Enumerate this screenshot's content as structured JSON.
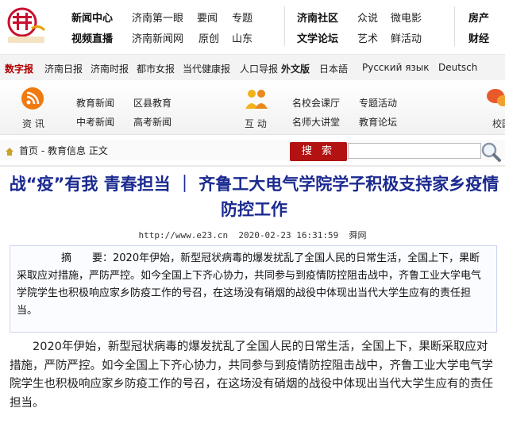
{
  "colors": {
    "accent_red": "#b00000",
    "title_blue": "#1b2a8f",
    "search_red": "#b31212"
  },
  "topnav": {
    "row1": [
      {
        "label": "新闻中心",
        "bold": true
      },
      {
        "label": "济南第一眼"
      },
      {
        "label": "要闻"
      },
      {
        "label": "专题"
      },
      {
        "label": "济南社区",
        "bold": true
      },
      {
        "label": "众说"
      },
      {
        "label": "微电影"
      },
      {
        "label": "房产",
        "bold": true
      }
    ],
    "row2": [
      {
        "label": "视频直播",
        "bold": true
      },
      {
        "label": "济南新闻网"
      },
      {
        "label": "原创"
      },
      {
        "label": "山东"
      },
      {
        "label": "文学论坛",
        "bold": true
      },
      {
        "label": "艺术"
      },
      {
        "label": "鲜活动"
      },
      {
        "label": "财经",
        "bold": true
      }
    ]
  },
  "papers": [
    "数字报",
    "济南日报",
    "济南时报",
    "都市女报",
    "当代健康报",
    "人口导报",
    "外文版",
    "日本語",
    "Русский язык",
    "Deutsch"
  ],
  "channels": {
    "zixun": {
      "label": "资 讯",
      "icon": "rss-feed-icon",
      "links": [
        "教育新闻",
        "区县教育",
        "中考新闻",
        "高考新闻"
      ]
    },
    "hudong": {
      "label": "互 动",
      "icon": "people-icon",
      "links": [
        "名校会课厅",
        "专题活动",
        "名师大讲堂",
        "教育论坛"
      ]
    },
    "xiaoyuan": {
      "label": "校园",
      "icon": "chat-bubbles-icon"
    }
  },
  "breadcrumb": {
    "home": "首页",
    "sep": " - ",
    "section": "教育信息",
    "current": " 正文"
  },
  "search": {
    "button": "搜 索",
    "placeholder": ""
  },
  "article": {
    "title": "战“疫”有我 青春担当 ｜ 齐鲁工大电气学院学子积极支持家乡疫情防控工作",
    "url": "http://www.e23.cn",
    "datetime": "2020-02-23 16:31:59",
    "source": "舜网",
    "summary_label": "摘　　要：",
    "summary": "2020年伊始，新型冠状病毒的爆发扰乱了全国人民的日常生活，全国上下，果断采取应对措施，严防严控。如今全国上下齐心协力，共同参与到疫情防控阻击战中，齐鲁工业大学电气学院学生也积极响应家乡防疫工作的号召，在这场没有硝烟的战役中体现出当代大学生应有的责任担当。",
    "body": "2020年伊始，新型冠状病毒的爆发扰乱了全国人民的日常生活，全国上下，果断采取应对措施，严防严控。如今全国上下齐心协力，共同参与到疫情防控阻击战中，齐鲁工业大学电气学院学生也积极响应家乡防疫工作的号召，在这场没有硝烟的战役中体现出当代大学生应有的责任担当。"
  }
}
